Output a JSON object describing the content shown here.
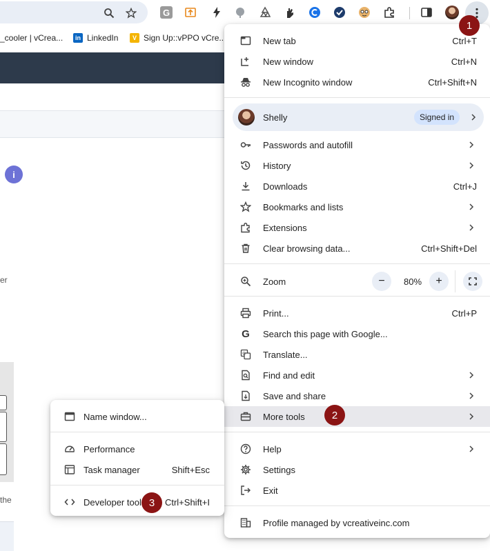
{
  "bookmarks": [
    {
      "label": "_cooler | vCrea...",
      "icon": "vcreative-favicon"
    },
    {
      "label": "LinkedIn",
      "icon": "linkedin-favicon"
    },
    {
      "label": "Sign Up::vPPO vCre...",
      "icon": "vppo-favicon"
    }
  ],
  "page_behind": {
    "info_glyph": "i",
    "fragment_1": "er",
    "fragment_2": "the"
  },
  "menu": {
    "new_tab": {
      "label": "New tab",
      "shortcut": "Ctrl+T"
    },
    "new_window": {
      "label": "New window",
      "shortcut": "Ctrl+N"
    },
    "new_incognito": {
      "label": "New Incognito window",
      "shortcut": "Ctrl+Shift+N"
    },
    "profile": {
      "name": "Shelly",
      "status": "Signed in"
    },
    "passwords": {
      "label": "Passwords and autofill"
    },
    "history": {
      "label": "History"
    },
    "downloads": {
      "label": "Downloads",
      "shortcut": "Ctrl+J"
    },
    "bookmarks": {
      "label": "Bookmarks and lists"
    },
    "extensions": {
      "label": "Extensions"
    },
    "clear_data": {
      "label": "Clear browsing data...",
      "shortcut": "Ctrl+Shift+Del"
    },
    "zoom": {
      "label": "Zoom",
      "value": "80%",
      "minus": "−",
      "plus": "+"
    },
    "print": {
      "label": "Print...",
      "shortcut": "Ctrl+P"
    },
    "search_google": {
      "label": "Search this page with Google..."
    },
    "translate": {
      "label": "Translate..."
    },
    "find_edit": {
      "label": "Find and edit"
    },
    "save_share": {
      "label": "Save and share"
    },
    "more_tools": {
      "label": "More tools"
    },
    "help": {
      "label": "Help"
    },
    "settings": {
      "label": "Settings"
    },
    "exit": {
      "label": "Exit"
    },
    "managed": {
      "label": "Profile managed by vcreativeinc.com"
    }
  },
  "submenu": {
    "name_window": {
      "label": "Name window..."
    },
    "performance": {
      "label": "Performance"
    },
    "task_manager": {
      "label": "Task manager",
      "shortcut": "Shift+Esc"
    },
    "developer_tools": {
      "label": "Developer tools",
      "shortcut": "Ctrl+Shift+I"
    }
  },
  "badges": {
    "one": "1",
    "two": "2",
    "three": "3"
  },
  "colors": {
    "badge": "#8b1414",
    "highlight": "#e8e8ec",
    "profile_pill": "#e9eef6",
    "signed_chip": "#d3e3fd"
  }
}
